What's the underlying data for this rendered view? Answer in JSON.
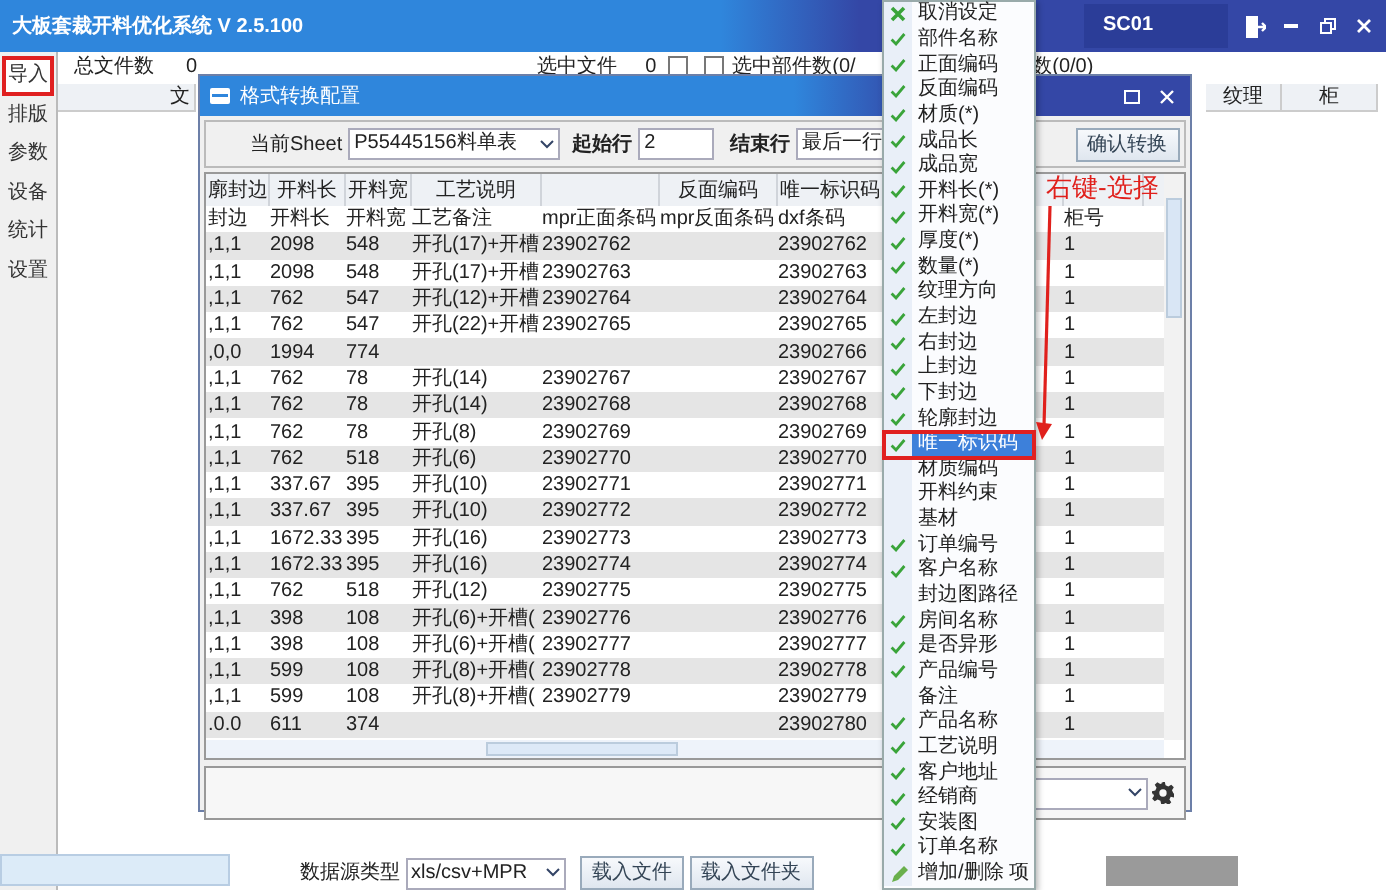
{
  "window": {
    "title": "大板套裁开料优化系统 V 2.5.100",
    "user": "SC01"
  },
  "sidebar": {
    "items": [
      {
        "label": "导入",
        "selected": true
      },
      {
        "label": "排版",
        "selected": false
      },
      {
        "label": "参数",
        "selected": false
      },
      {
        "label": "设备",
        "selected": false
      },
      {
        "label": "统计",
        "selected": false
      },
      {
        "label": "设置",
        "selected": false
      }
    ]
  },
  "main": {
    "file_count_label": "总文件数",
    "file_count": "0",
    "selected_files_label": "选中文件",
    "selected_files": "0",
    "selected_files_checked": false,
    "parts_label": "选中部件数(0/",
    "parts_checked": false,
    "parts_tail": "数(0/0)",
    "left_header": "文",
    "right_headers": [
      "纹理",
      "柜"
    ],
    "source_type_label": "数据源类型",
    "source_type": "xls/csv+MPR",
    "load_file": "载入文件",
    "load_folder": "载入文件夹"
  },
  "dialog": {
    "title": "格式转换配置",
    "sheet_label": "当前Sheet",
    "sheet": "P55445156料单表",
    "start_row_label": "起始行",
    "start_row": "2",
    "end_row_label": "结束行",
    "end_row": "最后一行",
    "confirm_button": "确认转换",
    "columns": [
      {
        "mapping": "廓封边",
        "source": "封边"
      },
      {
        "mapping": "开料长",
        "source": "开料长"
      },
      {
        "mapping": "开料宽",
        "source": "开料宽"
      },
      {
        "mapping": "工艺说明",
        "source": "工艺备注"
      },
      {
        "source": "mpr正面条码"
      },
      {
        "mapping": "反面编码",
        "source": "mpr反面条码"
      },
      {
        "mapping": "唯一标识码",
        "source": "dxf条码"
      },
      {
        "source": "柜号"
      }
    ],
    "rows": [
      [
        ",1,1",
        "2098",
        "548",
        "开孔(17)+开槽",
        "23902762",
        null,
        "23902762",
        "1"
      ],
      [
        ",1,1",
        "2098",
        "548",
        "开孔(17)+开槽",
        "23902763",
        null,
        "23902763",
        "1"
      ],
      [
        ",1,1",
        "762",
        "547",
        "开孔(12)+开槽",
        "23902764",
        null,
        "23902764",
        "1"
      ],
      [
        ",1,1",
        "762",
        "547",
        "开孔(22)+开槽",
        "23902765",
        null,
        "23902765",
        "1"
      ],
      [
        ",0,0",
        "1994",
        "774",
        null,
        null,
        null,
        "23902766",
        "1"
      ],
      [
        ",1,1",
        "762",
        "78",
        "开孔(14)",
        "23902767",
        null,
        "23902767",
        "1"
      ],
      [
        ",1,1",
        "762",
        "78",
        "开孔(14)",
        "23902768",
        null,
        "23902768",
        "1"
      ],
      [
        ",1,1",
        "762",
        "78",
        "开孔(8)",
        "23902769",
        null,
        "23902769",
        "1"
      ],
      [
        ",1,1",
        "762",
        "518",
        "开孔(6)",
        "23902770",
        null,
        "23902770",
        "1"
      ],
      [
        ",1,1",
        "337.67",
        "395",
        "开孔(10)",
        "23902771",
        null,
        "23902771",
        "1"
      ],
      [
        ",1,1",
        "337.67",
        "395",
        "开孔(10)",
        "23902772",
        null,
        "23902772",
        "1"
      ],
      [
        ",1,1",
        "1672.33",
        "395",
        "开孔(16)",
        "23902773",
        null,
        "23902773",
        "1"
      ],
      [
        ",1,1",
        "1672.33",
        "395",
        "开孔(16)",
        "23902774",
        null,
        "23902774",
        "1"
      ],
      [
        ",1,1",
        "762",
        "518",
        "开孔(12)",
        "23902775",
        null,
        "23902775",
        "1"
      ],
      [
        ",1,1",
        "398",
        "108",
        "开孔(6)+开槽(",
        "23902776",
        null,
        "23902776",
        "1"
      ],
      [
        ",1,1",
        "398",
        "108",
        "开孔(6)+开槽(",
        "23902777",
        null,
        "23902777",
        "1"
      ],
      [
        ",1,1",
        "599",
        "108",
        "开孔(8)+开槽(",
        "23902778",
        null,
        "23902778",
        "1"
      ],
      [
        ",1,1",
        "599",
        "108",
        "开孔(8)+开槽(",
        "23902779",
        null,
        "23902779",
        "1"
      ],
      [
        ".0.0",
        "611",
        "374",
        null,
        null,
        null,
        "23902780",
        "1"
      ]
    ]
  },
  "context_menu": {
    "items": [
      {
        "kind": "cancel",
        "label": "取消设定",
        "selected": false
      },
      {
        "kind": "option",
        "label": "部件名称",
        "checked": true,
        "selected": false
      },
      {
        "kind": "option",
        "label": "正面编码",
        "checked": true,
        "selected": false
      },
      {
        "kind": "option",
        "label": "反面编码",
        "checked": true,
        "selected": false
      },
      {
        "kind": "option",
        "label": "材质(*)",
        "checked": true,
        "selected": false
      },
      {
        "kind": "option",
        "label": "成品长",
        "checked": true,
        "selected": false
      },
      {
        "kind": "option",
        "label": "成品宽",
        "checked": true,
        "selected": false
      },
      {
        "kind": "option",
        "label": "开料长(*)",
        "checked": true,
        "selected": false
      },
      {
        "kind": "option",
        "label": "开料宽(*)",
        "checked": true,
        "selected": false
      },
      {
        "kind": "option",
        "label": "厚度(*)",
        "checked": true,
        "selected": false
      },
      {
        "kind": "option",
        "label": "数量(*)",
        "checked": true,
        "selected": false
      },
      {
        "kind": "option",
        "label": "纹理方向",
        "checked": true,
        "selected": false
      },
      {
        "kind": "option",
        "label": "左封边",
        "checked": true,
        "selected": false
      },
      {
        "kind": "option",
        "label": "右封边",
        "checked": true,
        "selected": false
      },
      {
        "kind": "option",
        "label": "上封边",
        "checked": true,
        "selected": false
      },
      {
        "kind": "option",
        "label": "下封边",
        "checked": true,
        "selected": false
      },
      {
        "kind": "option",
        "label": "轮廓封边",
        "checked": true,
        "selected": false
      },
      {
        "kind": "option",
        "label": "唯一标识码",
        "checked": true,
        "selected": true
      },
      {
        "kind": "option",
        "label": "材质编码",
        "checked": false,
        "selected": false
      },
      {
        "kind": "option",
        "label": "开料约束",
        "checked": false,
        "selected": false
      },
      {
        "kind": "option",
        "label": "基材",
        "checked": false,
        "selected": false
      },
      {
        "kind": "option",
        "label": "订单编号",
        "checked": true,
        "selected": false
      },
      {
        "kind": "option",
        "label": "客户名称",
        "checked": true,
        "selected": false
      },
      {
        "kind": "option",
        "label": "封边图路径",
        "checked": false,
        "selected": false
      },
      {
        "kind": "option",
        "label": "房间名称",
        "checked": true,
        "selected": false
      },
      {
        "kind": "option",
        "label": "是否异形",
        "checked": true,
        "selected": false
      },
      {
        "kind": "option",
        "label": "产品编号",
        "checked": true,
        "selected": false
      },
      {
        "kind": "option",
        "label": "备注",
        "checked": false,
        "selected": false
      },
      {
        "kind": "option",
        "label": "产品名称",
        "checked": true,
        "selected": false
      },
      {
        "kind": "option",
        "label": "工艺说明",
        "checked": true,
        "selected": false
      },
      {
        "kind": "option",
        "label": "客户地址",
        "checked": true,
        "selected": false
      },
      {
        "kind": "option",
        "label": "经销商",
        "checked": true,
        "selected": false
      },
      {
        "kind": "option",
        "label": "安装图",
        "checked": true,
        "selected": false
      },
      {
        "kind": "option",
        "label": "订单名称",
        "checked": true,
        "selected": false
      },
      {
        "kind": "edit",
        "label": "增加/删除 项",
        "selected": false
      }
    ]
  },
  "annotation": {
    "text": "右键-选择"
  }
}
